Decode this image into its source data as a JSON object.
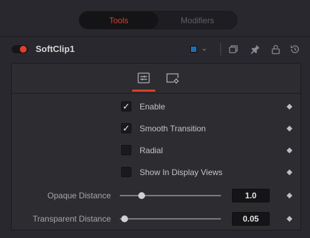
{
  "tabs": [
    {
      "label": "Tools",
      "active": true
    },
    {
      "label": "Modifiers",
      "active": false
    }
  ],
  "header": {
    "tool_name": "SoftClip1",
    "enabled": true,
    "swatch_color": "#1f6fb4",
    "icons": [
      "chevron-down-icon",
      "copy-icon",
      "pin-icon",
      "lock-icon",
      "reset-icon"
    ]
  },
  "control_tabs": [
    {
      "icon": "sliders-icon",
      "active": true
    },
    {
      "icon": "settings-panel-icon",
      "active": false
    }
  ],
  "checkboxes": [
    {
      "label": "Enable",
      "checked": true
    },
    {
      "label": "Smooth Transition",
      "checked": true
    },
    {
      "label": "Radial",
      "checked": false
    },
    {
      "label": "Show In Display Views",
      "checked": false
    }
  ],
  "sliders": [
    {
      "label": "Opaque Distance",
      "value": "1.0"
    },
    {
      "label": "Transparent Distance",
      "value": "0.05"
    }
  ],
  "colors": {
    "accent": "#d8422e",
    "background": "#28282e",
    "panel": "#2c2c31"
  }
}
